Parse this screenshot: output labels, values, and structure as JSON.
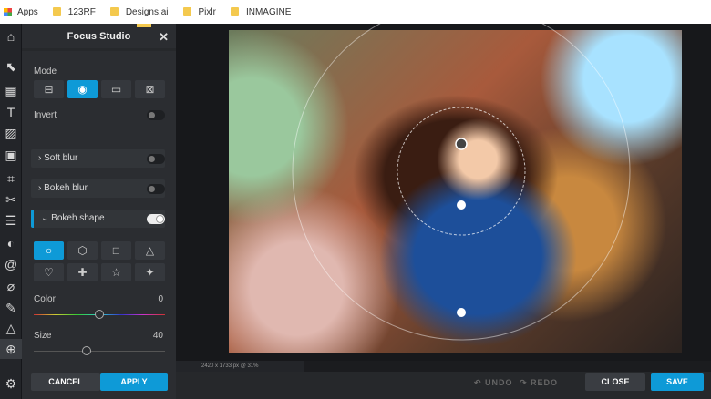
{
  "bookmarks": [
    {
      "label": "Apps",
      "icon": "apps-grid-icon"
    },
    {
      "label": "123RF"
    },
    {
      "label": "Designs.ai"
    },
    {
      "label": "Pixlr"
    },
    {
      "label": "INMAGINE"
    }
  ],
  "panel": {
    "title": "Focus Studio",
    "mode_label": "Mode",
    "invert_label": "Invert",
    "soft_blur": "Soft blur",
    "bokeh_blur": "Bokeh blur",
    "bokeh_shape": "Bokeh shape",
    "color_label": "Color",
    "color_value": "0",
    "size_label": "Size",
    "size_value": "40",
    "color_fraction": 0.5,
    "size_fraction": 0.4,
    "cancel": "CANCEL",
    "apply": "APPLY"
  },
  "modes": [
    "⊟",
    "◉",
    "▭",
    "⊠"
  ],
  "shapes": [
    "○",
    "⬡",
    "□",
    "△",
    "♡",
    "✚",
    "☆",
    "✦"
  ],
  "status": "2420 x 1733 px @ 31%",
  "bottom": {
    "undo": "↶ UNDO",
    "redo": "↷ REDO",
    "close": "CLOSE",
    "save": "SAVE"
  },
  "colors": {
    "accent": "#0e9ad7"
  }
}
